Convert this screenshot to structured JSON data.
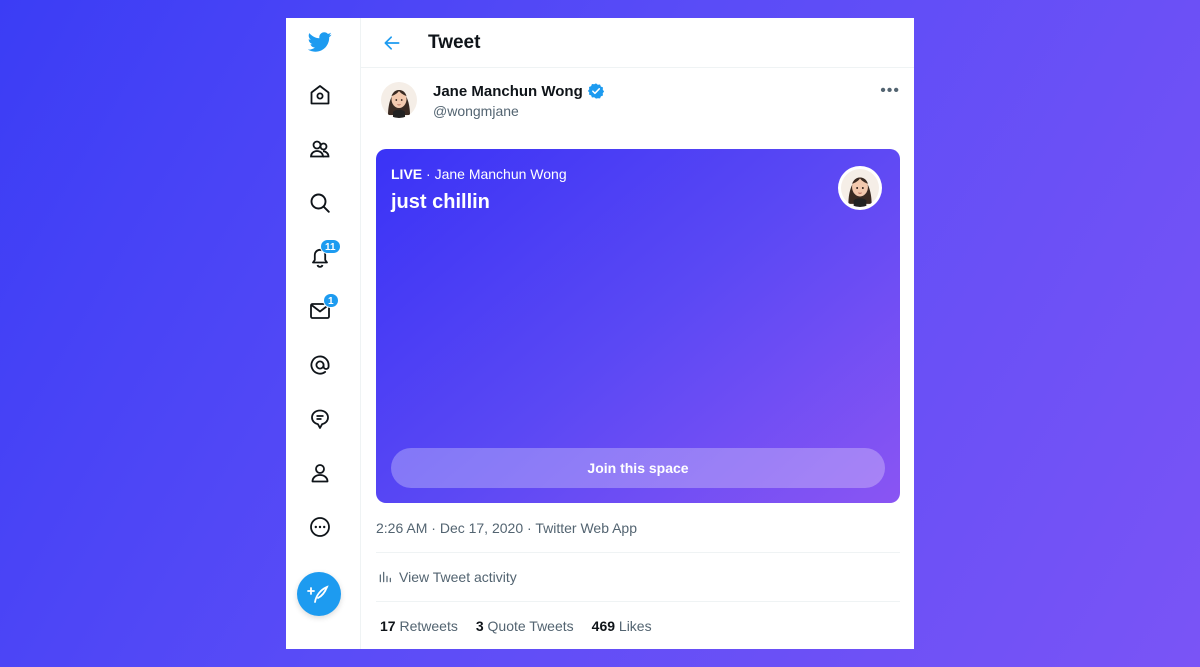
{
  "header": {
    "title": "Tweet"
  },
  "sidebar": {
    "notifications_badge": "11",
    "messages_badge": "1"
  },
  "author": {
    "display_name": "Jane Manchun Wong",
    "handle": "@wongmjane"
  },
  "space": {
    "live_label": "LIVE",
    "host_text": " · Jane Manchun Wong",
    "title": "just chillin",
    "join_label": "Join this space"
  },
  "tweet_meta": {
    "time": "2:26 AM",
    "sep1": " · ",
    "date": "Dec 17, 2020",
    "sep2": " · ",
    "source": "Twitter Web App"
  },
  "activity_label": "View Tweet activity",
  "stats": {
    "retweets_count": "17",
    "retweets_label": "Retweets",
    "quotes_count": "3",
    "quotes_label": "Quote Tweets",
    "likes_count": "469",
    "likes_label": "Likes"
  },
  "colors": {
    "accent": "#1d9bf0",
    "text_primary": "#0f1419",
    "text_secondary": "#536471",
    "background_gradient_start": "#3b3df5",
    "background_gradient_end": "#7a54f6"
  },
  "icons": [
    "twitter-logo-icon",
    "home-icon",
    "communities-icon",
    "search-icon",
    "notifications-icon",
    "messages-icon",
    "mentions-icon",
    "topics-icon",
    "profile-icon",
    "more-icon",
    "compose-icon",
    "back-arrow-icon",
    "verified-icon",
    "more-options-icon",
    "activity-chart-icon"
  ]
}
